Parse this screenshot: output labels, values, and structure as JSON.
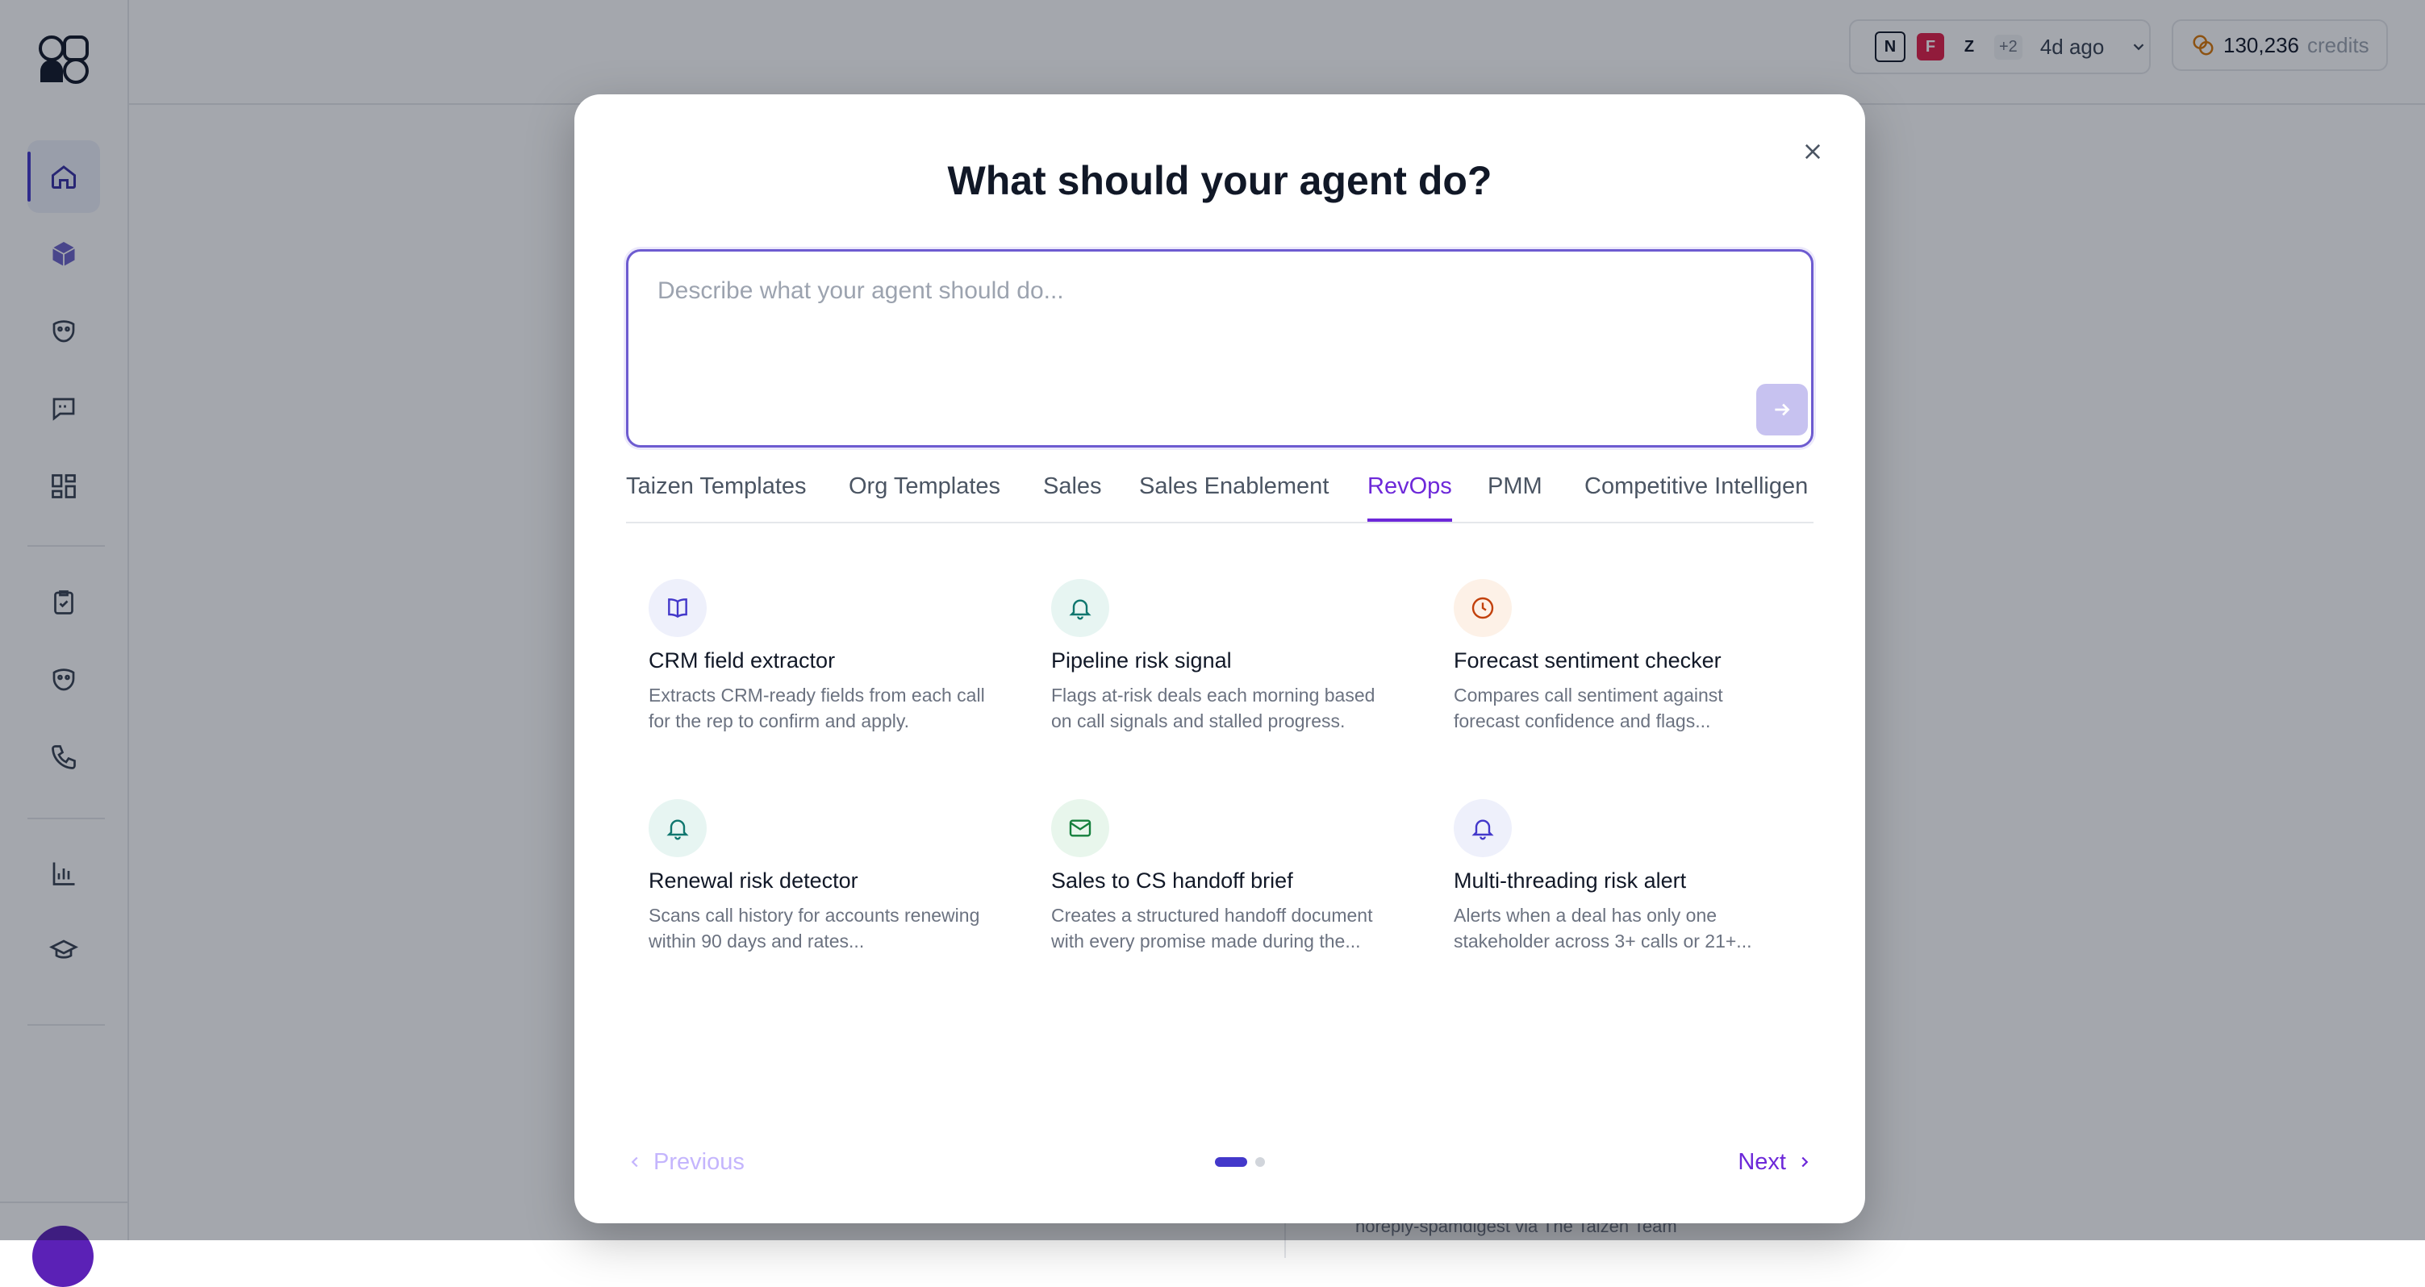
{
  "topbar": {
    "integrations_more": "+2",
    "last_sync": "4d ago",
    "credits_amount": "130,236",
    "credits_label": "credits"
  },
  "background": {
    "email_sender": "noreply-spamdigest via The Taizen Team"
  },
  "modal": {
    "title": "What should your agent do?",
    "prompt_placeholder": "Describe what your agent should do...",
    "prompt_value": "",
    "tabs": [
      {
        "label": "Taizen Templates",
        "active": false
      },
      {
        "label": "Org Templates",
        "active": false
      },
      {
        "label": "Sales",
        "active": false
      },
      {
        "label": "Sales Enablement",
        "active": false
      },
      {
        "label": "RevOps",
        "active": true
      },
      {
        "label": "PMM",
        "active": false
      },
      {
        "label": "Competitive Intelligen",
        "active": false
      }
    ],
    "templates": [
      {
        "title": "CRM field extractor",
        "description": "Extracts CRM-ready fields from each call for the rep to confirm and apply.",
        "icon": "book-icon",
        "icon_color": "#4338ca",
        "icon_bg": "#eef0fb"
      },
      {
        "title": "Pipeline risk signal",
        "description": "Flags at-risk deals each morning based on call signals and stalled progress.",
        "icon": "bell-icon",
        "icon_color": "#0f766e",
        "icon_bg": "#e7f5f2"
      },
      {
        "title": "Forecast sentiment checker",
        "description": "Compares call sentiment against forecast confidence and flags...",
        "icon": "clock-icon",
        "icon_color": "#c2410c",
        "icon_bg": "#fdf1e7"
      },
      {
        "title": "Renewal risk detector",
        "description": "Scans call history for accounts renewing within 90 days and rates...",
        "icon": "bell-icon",
        "icon_color": "#0f766e",
        "icon_bg": "#e7f5f2"
      },
      {
        "title": "Sales to CS handoff brief",
        "description": "Creates a structured handoff document with every promise made during the...",
        "icon": "mail-icon",
        "icon_color": "#15803d",
        "icon_bg": "#e8f6ec"
      },
      {
        "title": "Multi-threading risk alert",
        "description": "Alerts when a deal has only one stakeholder across 3+ calls or 21+...",
        "icon": "bell-icon",
        "icon_color": "#4338ca",
        "icon_bg": "#eef0fb"
      }
    ],
    "previous_label": "Previous",
    "next_label": "Next",
    "page_current": 1,
    "page_total": 2
  },
  "colors": {
    "accent": "#6d28d9",
    "nav_active": "#4338ca"
  }
}
